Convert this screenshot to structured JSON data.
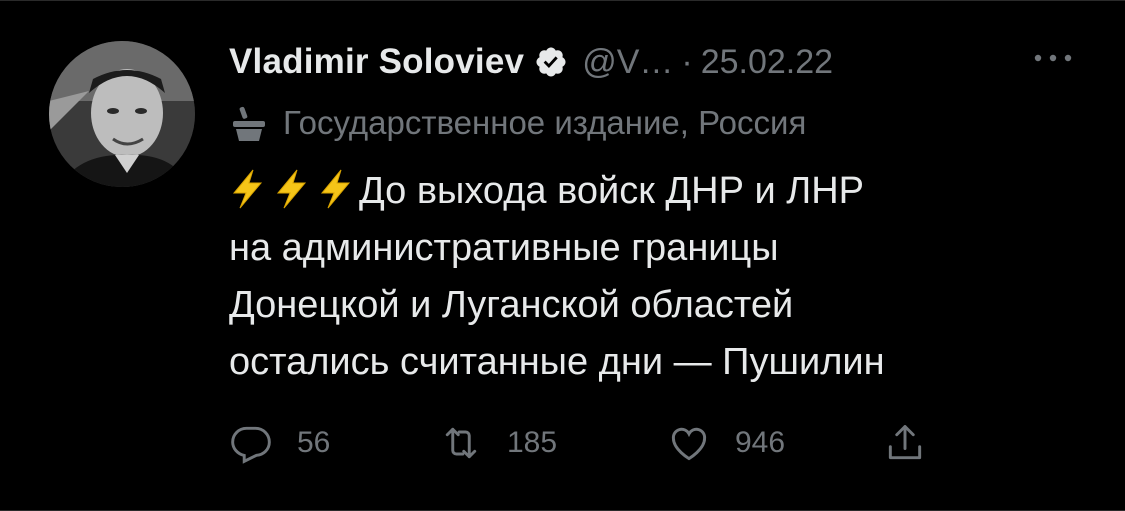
{
  "author": {
    "name": "Vladimir Soloviev",
    "handle": "@V…",
    "separator": "·",
    "date": "25.02.22"
  },
  "label": {
    "icon": "government-podium-icon",
    "text": "Государственное издание, Россия"
  },
  "tweet": {
    "emoji_icon": "high-voltage-icon",
    "lines": [
      "До выхода войск ДНР и ЛНР",
      "на административные границы",
      "Донецкой и Луганской областей",
      "остались считанные дни — Пушилин"
    ]
  },
  "actions": {
    "reply_count": "56",
    "retweet_count": "185",
    "like_count": "946"
  },
  "colors": {
    "background": "#000000",
    "text_primary": "#e7e9ea",
    "text_secondary": "#71767b",
    "bolt": "#f5c518"
  }
}
